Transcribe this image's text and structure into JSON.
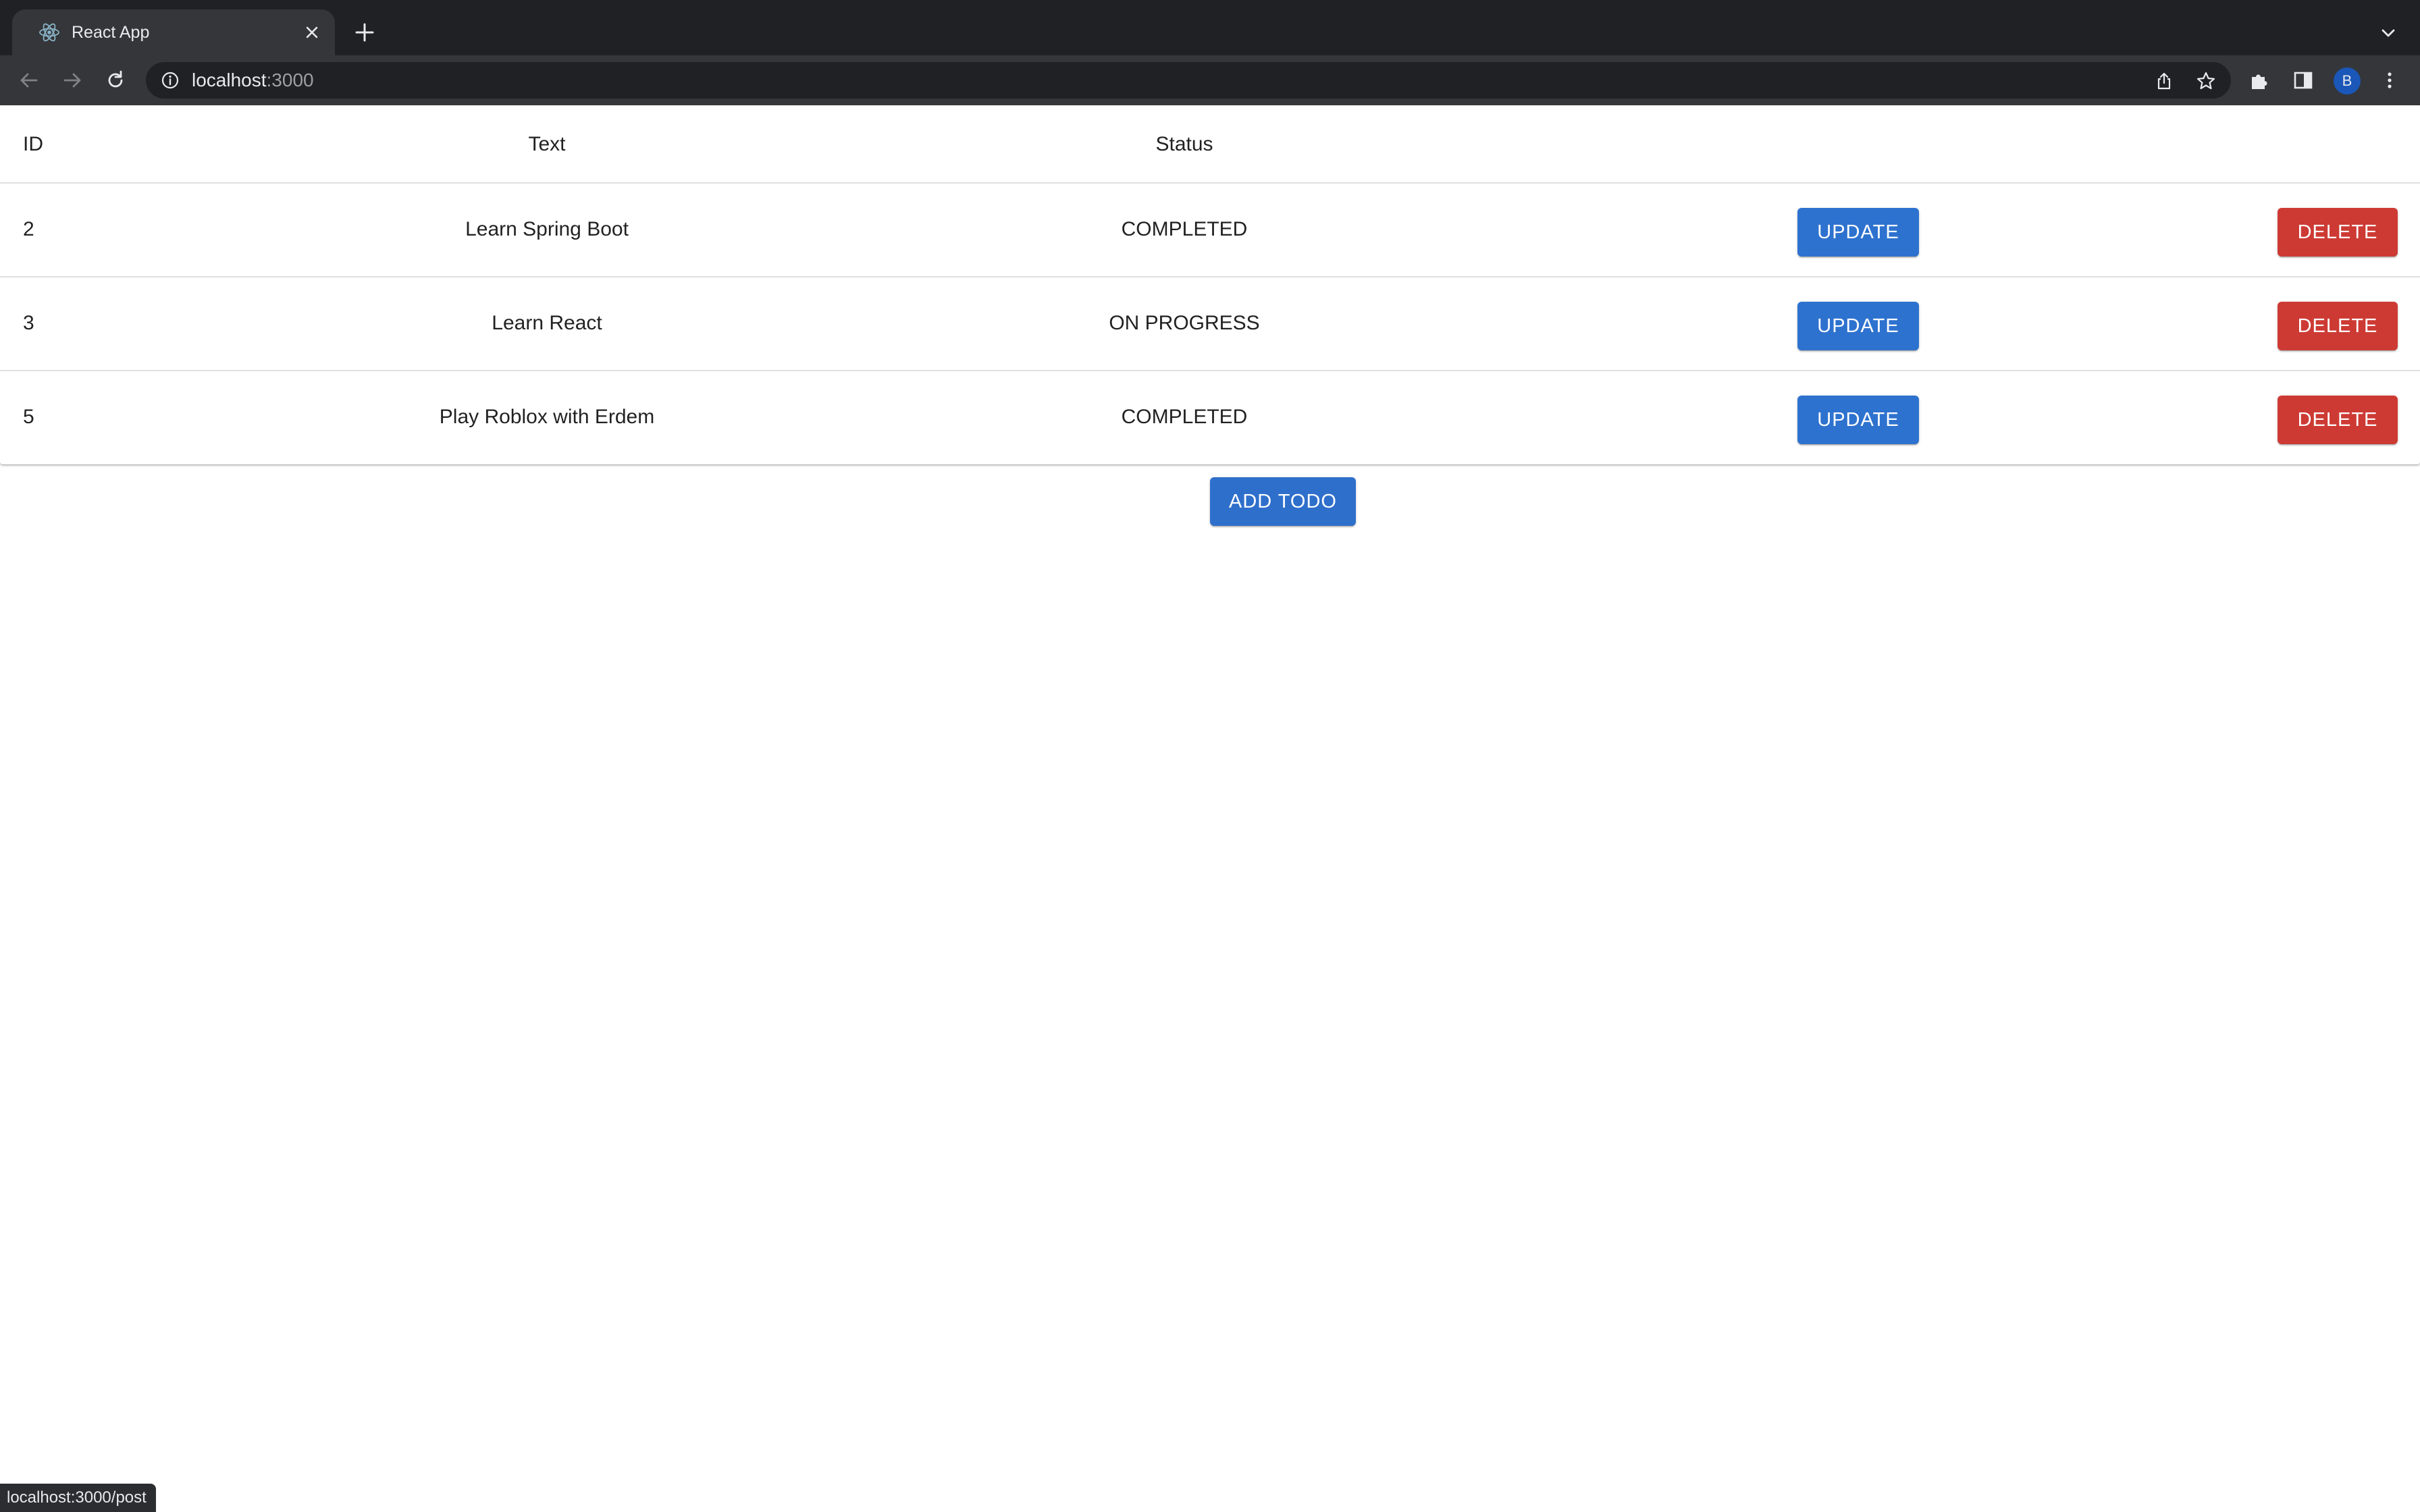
{
  "browser": {
    "tab_title": "React App",
    "url_host": "localhost",
    "url_port": ":3000",
    "profile_initial": "B",
    "status_url": "localhost:3000/post",
    "icons": {
      "tab_favicon": "react-logo-icon",
      "tab_close": "close-icon",
      "new_tab": "plus-icon",
      "tab_search": "chevron-down-icon",
      "back": "back-arrow-icon",
      "forward": "forward-arrow-icon",
      "reload": "reload-icon",
      "site_info": "info-icon",
      "share": "share-icon",
      "bookmark": "star-icon",
      "extensions": "puzzle-icon",
      "side_panel": "side-panel-icon",
      "menu": "kebab-menu-icon"
    }
  },
  "table": {
    "headers": [
      "ID",
      "Text",
      "Status"
    ],
    "rows": [
      {
        "id": "2",
        "text": "Learn Spring Boot",
        "status": "COMPLETED",
        "update_label": "UPDATE",
        "delete_label": "DELETE"
      },
      {
        "id": "3",
        "text": "Learn React",
        "status": "ON PROGRESS",
        "update_label": "UPDATE",
        "delete_label": "DELETE"
      },
      {
        "id": "5",
        "text": "Play Roblox with Erdem",
        "status": "COMPLETED",
        "update_label": "UPDATE",
        "delete_label": "DELETE"
      }
    ]
  },
  "actions": {
    "add_label": "ADD TODO"
  },
  "colors": {
    "primary": "#2e72cf",
    "error": "#cd3a34",
    "chrome_dark": "#202124",
    "chrome_toolbar": "#35363a"
  }
}
